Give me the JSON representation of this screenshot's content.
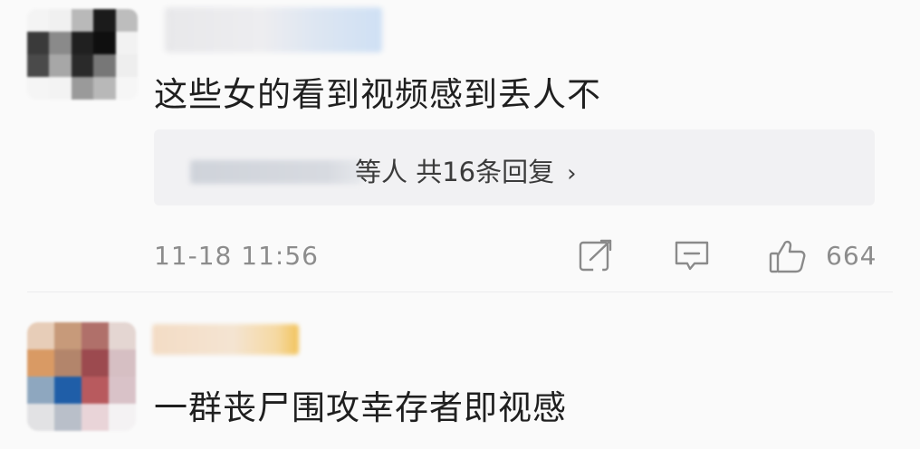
{
  "comments": [
    {
      "text": "这些女的看到视频感到丢人不",
      "replies_summary": "等人  共16条回复",
      "timestamp": "11-18 11:56",
      "like_count": "664",
      "avatar_colors": [
        "#f4f4f4",
        "#f0f0f0",
        "#b9b9b9",
        "#1b1b1b",
        "#bdbdbd",
        "#3a3a3a",
        "#8a8a8a",
        "#202020",
        "#0f0f0f",
        "#f2f2f2",
        "#4a4a4a",
        "#a7a7a7",
        "#2a2a2a",
        "#777777",
        "#eeeeee",
        "#f5f5f5",
        "#f3f3f3",
        "#9a9a9a",
        "#b8b8b8",
        "#f6f6f6"
      ]
    },
    {
      "text": "一群丧尸围攻幸存者即视感",
      "avatar_colors": [
        "#e7cdb8",
        "#c79a7a",
        "#b0706a",
        "#e4d6d2",
        "#d99a64",
        "#b3856b",
        "#9c4a4f",
        "#d6bfc3",
        "#8ea7bf",
        "#1f5ea8",
        "#b85a5e",
        "#d9c2c8",
        "#e2e2e4",
        "#b9bfc9",
        "#e9d4d8",
        "#f4f2f3"
      ]
    }
  ],
  "icons": {
    "share": "share-icon",
    "comment": "comment-icon",
    "like": "thumbs-up-icon",
    "chevron": "chevron-right-icon"
  },
  "colors": {
    "background": "#fafafa",
    "reply_box": "#f1f1f3",
    "meta_text": "#8c8c8c"
  }
}
